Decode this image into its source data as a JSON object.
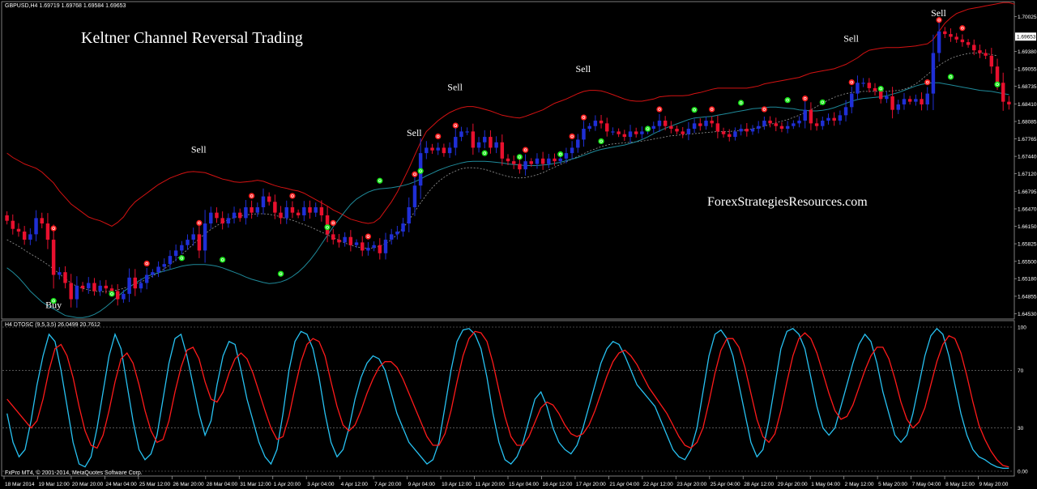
{
  "header": {
    "symbol_line": "GBPUSD,H4  1.69719 1.69768 1.69584 1.69653",
    "title": "Keltner Channel Reversal Trading",
    "watermark": "ForexStrategiesResources.com"
  },
  "osc_header": "H4 DTOSC (9,5,3,5) 26.0499 20.7612",
  "footer_credit": "FxPro MT4, © 2001-2014, MetaQuotes Software Corp.",
  "colors": {
    "background": "#000000",
    "bull_candle": "#1f2fd6",
    "bear_candle": "#e8102e",
    "upper_band": "#d41212",
    "middle_line": "#9a9a9a",
    "lower_band": "#1f8a9a",
    "fast_line": "#27c2f2",
    "slow_line": "#ff1a1a",
    "sell_dot": "#ff2020",
    "buy_dot": "#19e619"
  },
  "chart_data": [
    {
      "type": "candlestick",
      "symbol": "GBPUSD",
      "timeframe": "H4",
      "ohlc_header": {
        "open": 1.69719,
        "high": 1.69768,
        "low": 1.69584,
        "close": 1.69653
      },
      "last_price_label": "1.69653",
      "ylim": [
        1.6445,
        1.7015
      ],
      "y_ticks": [
        "1.70025",
        "1.69380",
        "1.69055",
        "1.68735",
        "1.68410",
        "1.68085",
        "1.67765",
        "1.67440",
        "1.67120",
        "1.66795",
        "1.66470",
        "1.66150",
        "1.65825",
        "1.65500",
        "1.65180",
        "1.64855",
        "1.64530"
      ],
      "x_ticks": [
        "18 Mar 2014",
        "19 Mar 12:00",
        "20 Mar 20:00",
        "24 Mar 04:00",
        "25 Mar 12:00",
        "26 Mar 20:00",
        "28 Mar 04:00",
        "31 Mar 12:00",
        "1 Apr 20:00",
        "3 Apr 04:00",
        "4 Apr 12:00",
        "7 Apr 20:00",
        "9 Apr 04:00",
        "10 Apr 12:00",
        "11 Apr 20:00",
        "15 Apr 04:00",
        "16 Apr 12:00",
        "17 Apr 20:00",
        "21 Apr 04:00",
        "22 Apr 12:00",
        "23 Apr 20:00",
        "25 Apr 04:00",
        "28 Apr 12:00",
        "29 Apr 20:00",
        "1 May 04:00",
        "2 May 12:00",
        "5 May 20:00",
        "7 May 04:00",
        "8 May 12:00",
        "9 May 20:00"
      ],
      "closes": [
        1.6625,
        1.661,
        1.6605,
        1.659,
        1.66,
        1.663,
        1.662,
        1.659,
        1.6525,
        1.653,
        1.651,
        1.648,
        1.6505,
        1.65,
        1.651,
        1.6495,
        1.6505,
        1.65,
        1.6495,
        1.648,
        1.649,
        1.652,
        1.65,
        1.651,
        1.6525,
        1.653,
        1.654,
        1.6545,
        1.656,
        1.657,
        1.658,
        1.659,
        1.66,
        1.657,
        1.662,
        1.664,
        1.663,
        1.662,
        1.663,
        1.664,
        1.663,
        1.665,
        1.664,
        1.665,
        1.667,
        1.666,
        1.664,
        1.663,
        1.665,
        1.664,
        1.6635,
        1.665,
        1.664,
        1.665,
        1.6635,
        1.66,
        1.659,
        1.6585,
        1.6595,
        1.658,
        1.6585,
        1.657,
        1.6575,
        1.658,
        1.6565,
        1.659,
        1.66,
        1.6605,
        1.662,
        1.665,
        1.669,
        1.675,
        1.676,
        1.6755,
        1.676,
        1.675,
        1.676,
        1.678,
        1.679,
        1.679,
        1.676,
        1.677,
        1.678,
        1.676,
        1.677,
        1.674,
        1.6735,
        1.673,
        1.672,
        1.6735,
        1.673,
        1.674,
        1.673,
        1.674,
        1.6735,
        1.674,
        1.675,
        1.676,
        1.6775,
        1.6795,
        1.68,
        1.681,
        1.6805,
        1.679,
        1.679,
        1.6785,
        1.678,
        1.679,
        1.6785,
        1.679,
        1.6795,
        1.68,
        1.681,
        1.68,
        1.6795,
        1.679,
        1.6785,
        1.6795,
        1.6805,
        1.68,
        1.681,
        1.6805,
        1.679,
        1.6785,
        1.678,
        1.679,
        1.6795,
        1.679,
        1.6795,
        1.68,
        1.681,
        1.6805,
        1.68,
        1.6795,
        1.68,
        1.6805,
        1.681,
        1.683,
        1.6805,
        1.68,
        1.681,
        1.6815,
        1.681,
        1.682,
        1.6835,
        1.686,
        1.688,
        1.688,
        1.687,
        1.6865,
        1.685,
        1.6855,
        1.683,
        1.684,
        1.685,
        1.6845,
        1.685,
        1.684,
        1.686,
        1.6935,
        1.6975,
        1.697,
        1.6965,
        1.696,
        1.6955,
        1.695,
        1.694,
        1.6935,
        1.693,
        1.691,
        1.688,
        1.6845,
        1.684
      ],
      "upper_band": [
        1.675,
        1.6742,
        1.6736,
        1.673,
        1.6726,
        1.6722,
        1.6715,
        1.6705,
        1.6695,
        1.668,
        1.6668,
        1.6656,
        1.6648,
        1.664,
        1.6632,
        1.6628,
        1.6625,
        1.662,
        1.6615,
        1.6622,
        1.6632,
        1.6648,
        1.666,
        1.6668,
        1.6676,
        1.6684,
        1.6692,
        1.6698,
        1.6704,
        1.6708,
        1.6712,
        1.6715,
        1.6716,
        1.6715,
        1.6714,
        1.671,
        1.6706,
        1.6702,
        1.67,
        1.6697,
        1.6696,
        1.6697,
        1.6698,
        1.67,
        1.6698,
        1.6694,
        1.669,
        1.6687,
        1.6685,
        1.6682,
        1.668,
        1.6676,
        1.667,
        1.6664,
        1.6658,
        1.6652,
        1.6645,
        1.664,
        1.6634,
        1.6628,
        1.6625,
        1.6622,
        1.662,
        1.6622,
        1.663,
        1.6645,
        1.666,
        1.6678,
        1.67,
        1.6722,
        1.6746,
        1.677,
        1.679,
        1.68,
        1.681,
        1.6818,
        1.6825,
        1.683,
        1.6834,
        1.6836,
        1.6836,
        1.6834,
        1.6831,
        1.6828,
        1.6824,
        1.682,
        1.6818,
        1.6816,
        1.6815,
        1.6818,
        1.6822,
        1.6826,
        1.683,
        1.6836,
        1.6842,
        1.6846,
        1.685,
        1.6855,
        1.686,
        1.6864,
        1.6866,
        1.6866,
        1.6865,
        1.6862,
        1.6858,
        1.6854,
        1.685,
        1.6847,
        1.6846,
        1.6846,
        1.6848,
        1.685,
        1.6854,
        1.6855,
        1.6856,
        1.6856,
        1.6856,
        1.6857,
        1.686,
        1.6862,
        1.6865,
        1.6868,
        1.687,
        1.687,
        1.687,
        1.687,
        1.687,
        1.687,
        1.6872,
        1.6874,
        1.6878,
        1.688,
        1.6882,
        1.6884,
        1.6886,
        1.6888,
        1.689,
        1.6894,
        1.6898,
        1.69,
        1.6902,
        1.6904,
        1.6906,
        1.691,
        1.6914,
        1.692,
        1.6926,
        1.6934,
        1.694,
        1.6942,
        1.6944,
        1.6945,
        1.6945,
        1.6945,
        1.6946,
        1.6947,
        1.6948,
        1.695,
        1.6952,
        1.696,
        1.6975,
        1.699,
        1.7,
        1.7008,
        1.7012,
        1.7016,
        1.7018,
        1.702,
        1.7022,
        1.7024,
        1.7026,
        1.7028,
        1.7028,
        1.7025
      ],
      "middle_line": [
        1.659,
        1.6584,
        1.6578,
        1.6571,
        1.6564,
        1.6558,
        1.6551,
        1.6544,
        1.6536,
        1.6527,
        1.6518,
        1.651,
        1.6504,
        1.65,
        1.6497,
        1.6495,
        1.6494,
        1.6494,
        1.6495,
        1.6497,
        1.65,
        1.6504,
        1.6508,
        1.6512,
        1.6517,
        1.6523,
        1.6529,
        1.6536,
        1.6544,
        1.6553,
        1.6562,
        1.6572,
        1.6582,
        1.6592,
        1.6601,
        1.6609,
        1.6616,
        1.6622,
        1.6627,
        1.6631,
        1.6634,
        1.6636,
        1.6637,
        1.6638,
        1.6638,
        1.6637,
        1.6635,
        1.6632,
        1.6629,
        1.6626,
        1.6622,
        1.6618,
        1.6614,
        1.6609,
        1.6604,
        1.6599,
        1.6594,
        1.6589,
        1.6584,
        1.658,
        1.6577,
        1.6575,
        1.6574,
        1.6575,
        1.6578,
        1.6583,
        1.659,
        1.66,
        1.6612,
        1.6626,
        1.6642,
        1.6658,
        1.6673,
        1.6686,
        1.6697,
        1.6705,
        1.6712,
        1.6717,
        1.6721,
        1.6723,
        1.6723,
        1.6722,
        1.672,
        1.6717,
        1.6713,
        1.671,
        1.6707,
        1.6705,
        1.6704,
        1.6705,
        1.6707,
        1.671,
        1.6714,
        1.6719,
        1.6724,
        1.6729,
        1.6734,
        1.6739,
        1.6744,
        1.6749,
        1.6754,
        1.6758,
        1.6762,
        1.6765,
        1.6767,
        1.6768,
        1.6769,
        1.677,
        1.6771,
        1.6772,
        1.6774,
        1.6776,
        1.6778,
        1.678,
        1.6782,
        1.6783,
        1.6784,
        1.6785,
        1.6786,
        1.6787,
        1.6788,
        1.6789,
        1.679,
        1.679,
        1.679,
        1.6791,
        1.6792,
        1.6793,
        1.6795,
        1.6797,
        1.68,
        1.6803,
        1.6806,
        1.6809,
        1.6812,
        1.6816,
        1.682,
        1.6825,
        1.683,
        1.6836,
        1.6842,
        1.6848,
        1.6853,
        1.6857,
        1.686,
        1.6862,
        1.6863,
        1.6864,
        1.6864,
        1.6864,
        1.6864,
        1.6864,
        1.6865,
        1.6866,
        1.6868,
        1.6872,
        1.6878,
        1.6886,
        1.6895,
        1.6904,
        1.6912,
        1.6919,
        1.6925,
        1.6929,
        1.6932,
        1.6934,
        1.6935,
        1.6935,
        1.6934,
        1.6932,
        1.693
      ],
      "lower_band": [
        1.6538,
        1.653,
        1.652,
        1.6508,
        1.6495,
        1.6485,
        1.6475,
        1.6468,
        1.6462,
        1.6456,
        1.645,
        1.6448,
        1.6446,
        1.6446,
        1.6448,
        1.6452,
        1.6458,
        1.6466,
        1.6475,
        1.6485,
        1.6494,
        1.6502,
        1.651,
        1.6516,
        1.6522,
        1.6526,
        1.6529,
        1.6532,
        1.6535,
        1.6538,
        1.6541,
        1.6543,
        1.6544,
        1.6544,
        1.6544,
        1.6543,
        1.6541,
        1.6538,
        1.6534,
        1.653,
        1.6526,
        1.6521,
        1.6517,
        1.6514,
        1.6511,
        1.6509,
        1.651,
        1.6512,
        1.6516,
        1.6522,
        1.653,
        1.654,
        1.6552,
        1.6566,
        1.6582,
        1.6598,
        1.6614,
        1.6628,
        1.6642,
        1.6655,
        1.6665,
        1.6672,
        1.6678,
        1.6682,
        1.6684,
        1.6685,
        1.6686,
        1.6688,
        1.669,
        1.6693,
        1.6697,
        1.6702,
        1.6708,
        1.6713,
        1.6718,
        1.6722,
        1.6726,
        1.6729,
        1.6732,
        1.6734,
        1.6735,
        1.6735,
        1.6735,
        1.6734,
        1.6733,
        1.6732,
        1.673,
        1.6729,
        1.6728,
        1.6727,
        1.6727,
        1.6727,
        1.6728,
        1.6729,
        1.6731,
        1.6733,
        1.6736,
        1.6739,
        1.6742,
        1.6746,
        1.675,
        1.6754,
        1.6757,
        1.6759,
        1.6761,
        1.6763,
        1.6765,
        1.6768,
        1.6771,
        1.6775,
        1.678,
        1.6786,
        1.6791,
        1.6796,
        1.68,
        1.6804,
        1.6808,
        1.6812,
        1.6815,
        1.6816,
        1.6817,
        1.6818,
        1.682,
        1.6822,
        1.6824,
        1.6826,
        1.6828,
        1.683,
        1.6832,
        1.6833,
        1.6834,
        1.6835,
        1.6835,
        1.6834,
        1.6833,
        1.6832,
        1.683,
        1.6829,
        1.6828,
        1.6828,
        1.6829,
        1.6831,
        1.6834,
        1.6838,
        1.6842,
        1.6846,
        1.6849,
        1.6851,
        1.6852,
        1.6853,
        1.6854,
        1.6856,
        1.6859,
        1.6862,
        1.6866,
        1.687,
        1.6874,
        1.6877,
        1.6879,
        1.688,
        1.688,
        1.6878,
        1.6876,
        1.6874,
        1.6872,
        1.687,
        1.6868,
        1.6866,
        1.6865,
        1.6864,
        1.6862,
        1.686,
        1.6858
      ],
      "signals": [
        {
          "label": "Buy",
          "bar": 8
        },
        {
          "label": "Sell",
          "bar": 33
        },
        {
          "label": "Sell",
          "bar": 70
        },
        {
          "label": "Sell",
          "bar": 77
        },
        {
          "label": "Sell",
          "bar": 99
        },
        {
          "label": "Sell",
          "bar": 145
        },
        {
          "label": "Sell",
          "bar": 160
        }
      ]
    },
    {
      "type": "line",
      "indicator": "DTOSC",
      "params": "9,5,3,5",
      "values_header": [
        26.0499,
        20.7612
      ],
      "ylim": [
        0,
        100
      ],
      "y_ticks": [
        "100",
        "70",
        "30",
        "0.00"
      ],
      "levels": [
        100,
        70,
        30,
        0
      ],
      "series": [
        {
          "values": [
            40,
            20,
            10,
            15,
            35,
            60,
            80,
            95,
            90,
            70,
            45,
            20,
            5,
            3,
            10,
            30,
            55,
            80,
            95,
            85,
            60,
            35,
            15,
            8,
            12,
            25,
            50,
            75,
            92,
            95,
            80,
            60,
            40,
            25,
            35,
            60,
            80,
            90,
            88,
            70,
            50,
            35,
            20,
            10,
            5,
            15,
            40,
            70,
            90,
            97,
            95,
            85,
            65,
            40,
            20,
            10,
            15,
            30,
            50,
            65,
            75,
            80,
            78,
            70,
            55,
            40,
            30,
            20,
            15,
            10,
            5,
            8,
            20,
            45,
            70,
            90,
            98,
            99,
            95,
            85,
            65,
            40,
            20,
            8,
            5,
            10,
            20,
            35,
            50,
            55,
            45,
            30,
            20,
            15,
            12,
            18,
            30,
            45,
            60,
            75,
            85,
            90,
            88,
            80,
            70,
            60,
            55,
            50,
            45,
            35,
            25,
            15,
            10,
            8,
            15,
            30,
            55,
            80,
            95,
            98,
            92,
            80,
            60,
            40,
            20,
            10,
            15,
            35,
            60,
            85,
            97,
            99,
            95,
            85,
            65,
            45,
            30,
            25,
            30,
            45,
            60,
            75,
            88,
            95,
            90,
            75,
            55,
            40,
            25,
            20,
            25,
            40,
            60,
            80,
            94,
            99,
            95,
            80,
            60,
            40,
            25,
            15,
            10,
            8,
            5,
            3,
            2,
            2
          ]
        },
        {
          "values": [
            50,
            45,
            40,
            35,
            30,
            35,
            50,
            70,
            85,
            88,
            80,
            65,
            45,
            28,
            18,
            16,
            25,
            42,
            62,
            78,
            82,
            75,
            60,
            42,
            28,
            20,
            22,
            35,
            55,
            72,
            84,
            86,
            78,
            62,
            50,
            48,
            55,
            68,
            78,
            82,
            78,
            68,
            55,
            42,
            30,
            22,
            24,
            38,
            58,
            76,
            88,
            92,
            90,
            80,
            62,
            45,
            32,
            28,
            32,
            42,
            54,
            64,
            72,
            76,
            76,
            72,
            64,
            54,
            44,
            34,
            24,
            18,
            18,
            26,
            42,
            62,
            80,
            92,
            97,
            96,
            90,
            75,
            56,
            38,
            24,
            18,
            18,
            24,
            34,
            44,
            48,
            46,
            40,
            32,
            26,
            24,
            26,
            32,
            42,
            54,
            66,
            76,
            82,
            84,
            80,
            74,
            66,
            58,
            52,
            46,
            40,
            32,
            24,
            18,
            16,
            20,
            30,
            48,
            68,
            84,
            92,
            92,
            86,
            72,
            54,
            36,
            24,
            20,
            26,
            42,
            62,
            80,
            92,
            96,
            92,
            82,
            68,
            54,
            42,
            36,
            38,
            46,
            58,
            70,
            80,
            86,
            86,
            78,
            64,
            48,
            36,
            30,
            34,
            44,
            60,
            76,
            88,
            94,
            92,
            82,
            66,
            48,
            32,
            22,
            14,
            8,
            4,
            3
          ]
        }
      ]
    }
  ]
}
